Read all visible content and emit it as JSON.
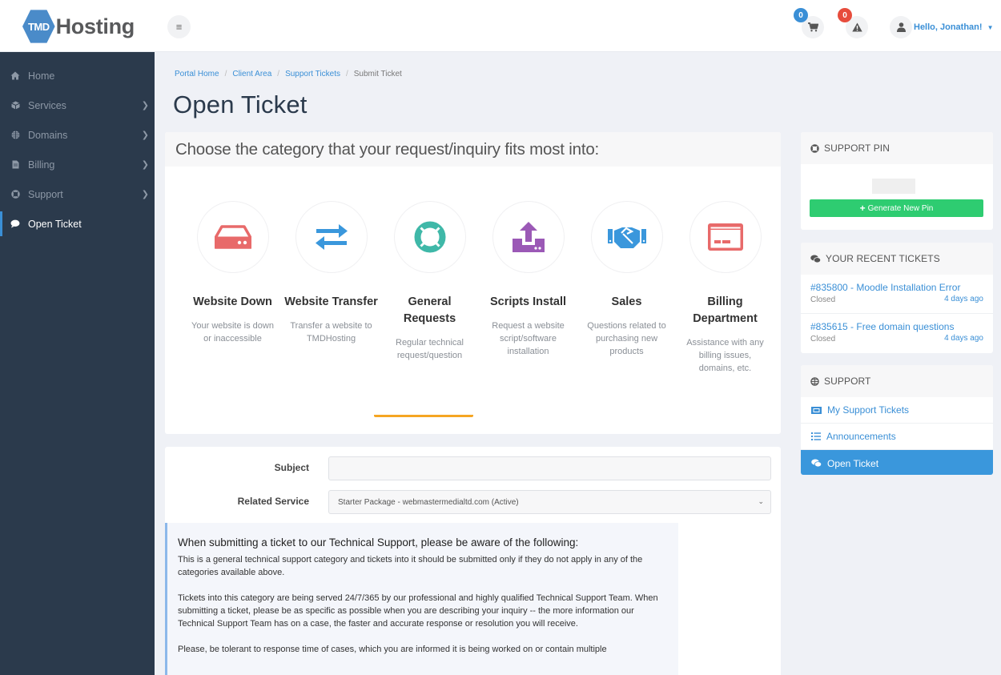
{
  "header": {
    "logo_mark": "TMD",
    "logo_word": "Hosting",
    "cart_count": "0",
    "alerts_count": "0",
    "user_greeting": "Hello, Jonathan!",
    "colors": {
      "cart_badge": "#3a8fd6",
      "alert_badge": "#e74c3c"
    }
  },
  "sidebar": {
    "items": [
      {
        "label": "Home",
        "icon": "home-icon",
        "has_submenu": false
      },
      {
        "label": "Services",
        "icon": "cube-icon",
        "has_submenu": true
      },
      {
        "label": "Domains",
        "icon": "globe-icon",
        "has_submenu": true
      },
      {
        "label": "Billing",
        "icon": "invoice-icon",
        "has_submenu": true
      },
      {
        "label": "Support",
        "icon": "life-ring-icon",
        "has_submenu": true
      },
      {
        "label": "Open Ticket",
        "icon": "comment-icon",
        "has_submenu": false,
        "active": true
      }
    ]
  },
  "breadcrumb": [
    {
      "label": "Portal Home",
      "link": true
    },
    {
      "label": "Client Area",
      "link": true
    },
    {
      "label": "Support Tickets",
      "link": true
    },
    {
      "label": "Submit Ticket",
      "link": false
    }
  ],
  "page_title": "Open Ticket",
  "categories": {
    "heading": "Choose the category that your request/inquiry fits most into:",
    "selected_index": 2,
    "items": [
      {
        "title": "Website Down",
        "description": "Your website is down or inaccessible",
        "icon": "server-icon",
        "color": "#e86a6a"
      },
      {
        "title": "Website Transfer",
        "description": "Transfer a website to TMDHosting",
        "icon": "exchange-icon",
        "color": "#3a97dc"
      },
      {
        "title": "General Requests",
        "description": "Regular technical request/question",
        "icon": "life-ring-icon",
        "color": "#3fb8a8"
      },
      {
        "title": "Scripts Install",
        "description": "Request a website script/software installation",
        "icon": "upload-icon",
        "color": "#9b59b6"
      },
      {
        "title": "Sales",
        "description": "Questions related to purchasing new products",
        "icon": "handshake-icon",
        "color": "#3a97dc"
      },
      {
        "title": "Billing Department",
        "description": "Assistance with any billing issues, domains, etc.",
        "icon": "credit-card-icon",
        "color": "#e86a6a"
      }
    ],
    "accent_color": "#f5a623"
  },
  "form": {
    "subject_label": "Subject",
    "subject_value": "",
    "service_label": "Related Service",
    "service_value": "Starter Package - webmastermedialtd.com (Active)"
  },
  "notice": {
    "heading": "When submitting a ticket to our Technical Support, please be aware of the following:",
    "paragraphs": [
      "This is a general technical support category and tickets into it should be submitted only if they do not apply in any of the categories available above.",
      "Tickets into this category are being served 24/7/365 by our professional and highly qualified Technical Support Team. When submitting a ticket, please be as specific as possible when you are describing your inquiry -- the more information our Technical Support Team has on a case, the faster and accurate response or resolution you will receive.",
      "Please, be tolerant to response time of cases, which you are informed it is being worked on or contain multiple"
    ]
  },
  "support_pin": {
    "title": "SUPPORT PIN",
    "button_label": "Generate New Pin",
    "button_color": "#2ecc71"
  },
  "recent_tickets": {
    "title": "YOUR RECENT TICKETS",
    "items": [
      {
        "title": "#835800 - Moodle Installation Error",
        "status": "Closed",
        "time": "4 days ago"
      },
      {
        "title": "#835615 - Free domain questions",
        "status": "Closed",
        "time": "4 days ago"
      }
    ]
  },
  "support_links": {
    "title": "SUPPORT",
    "items": [
      {
        "label": "My Support Tickets",
        "icon": "ticket-icon",
        "active": false
      },
      {
        "label": "Announcements",
        "icon": "list-icon",
        "active": false
      },
      {
        "label": "Open Ticket",
        "icon": "comments-icon",
        "active": true
      }
    ]
  }
}
